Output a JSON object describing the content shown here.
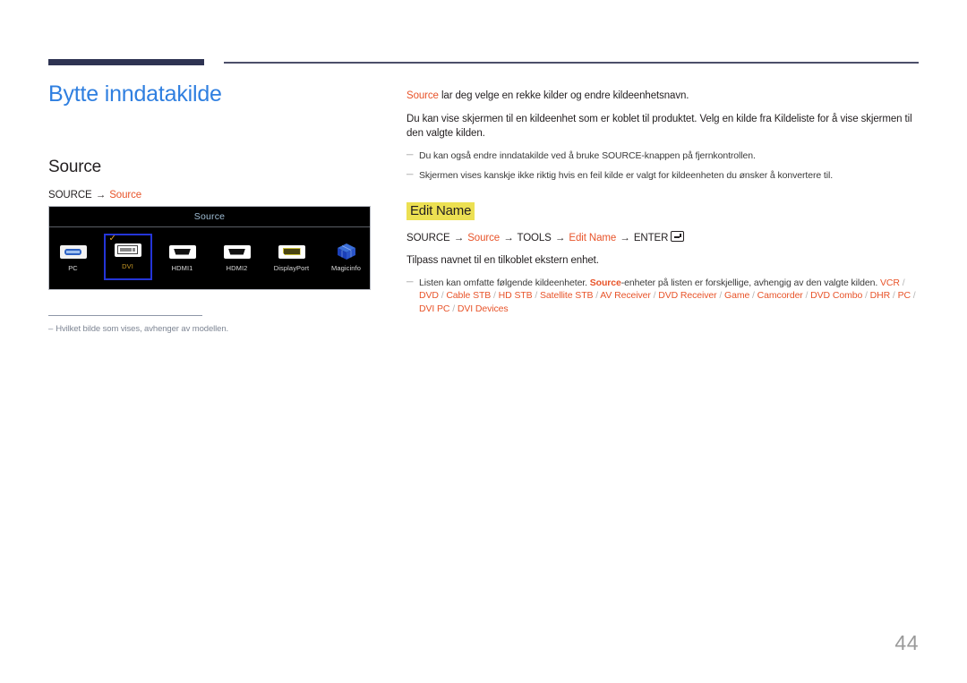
{
  "header": {
    "rule_accent_color": "#2e3352",
    "rule_thin_color": "#4c4f69"
  },
  "left": {
    "page_title": "Bytte inndatakilde",
    "section_title": "Source",
    "path": {
      "root": "SOURCE",
      "arrow": "→",
      "target": "Source"
    },
    "footnote_dash": "–",
    "footnote": "Hvilket bilde som vises, avhenger av modellen."
  },
  "osd": {
    "title": "Source",
    "items": [
      {
        "label": "PC",
        "icon": "vga-plug-icon",
        "selected": false
      },
      {
        "label": "DVI",
        "icon": "dvi-plug-icon",
        "selected": true
      },
      {
        "label": "HDMI1",
        "icon": "hdmi-plug-icon",
        "selected": false
      },
      {
        "label": "HDMI2",
        "icon": "hdmi-plug-icon",
        "selected": false
      },
      {
        "label": "DisplayPort",
        "icon": "displayport-plug-icon",
        "selected": false
      },
      {
        "label": "Magicinfo",
        "icon": "magicinfo-cube-icon",
        "selected": false
      }
    ],
    "check_glyph": "✓",
    "selected_border_color": "#2435d8",
    "selected_label_color": "#c99a26",
    "title_color": "#9fbdd4"
  },
  "right": {
    "intro_accent": "Source",
    "intro_rest": " lar deg velge en rekke kilder og endre kildeenhetsnavn.",
    "paragraph": "Du kan vise skjermen til en kildeenhet som er koblet til produktet. Velg en kilde fra Kildeliste for å vise skjermen til den valgte kilden.",
    "notes": [
      "Du kan også endre inndatakilde ved å bruke SOURCE-knappen på fjernkontrollen.",
      "Skjermen vises kanskje ikke riktig hvis en feil kilde er valgt for kildeenheten du ønsker å konvertere til."
    ],
    "note_dash": "─",
    "edit_name_heading": "Edit Name",
    "edit_name_highlight": "#ece052",
    "path2": {
      "p1": "SOURCE",
      "a1": "→",
      "p2": "Source",
      "a2": "→",
      "p3": "TOOLS",
      "a3": "→",
      "p4": "Edit Name",
      "a4": "→",
      "p5": "ENTER",
      "key_icon": "enter-key-icon"
    },
    "edit_name_para": "Tilpass navnet til en tilkoblet ekstern enhet.",
    "list_note_part1": "Listen kan omfatte følgende kildeenheter. ",
    "list_note_accent": "Source",
    "list_note_part2": "-enheter på listen er forskjellige, avhengig av den valgte kilden.",
    "devices": [
      "VCR",
      "DVD",
      "Cable STB",
      "HD STB",
      "Satellite STB",
      "AV Receiver",
      "DVD Receiver",
      "Game",
      "Camcorder",
      "DVD Combo",
      "DHR",
      "PC",
      "DVI PC",
      "DVI Devices"
    ],
    "device_separator": " / ",
    "accent_color": "#e8542a"
  },
  "page_number": "44"
}
